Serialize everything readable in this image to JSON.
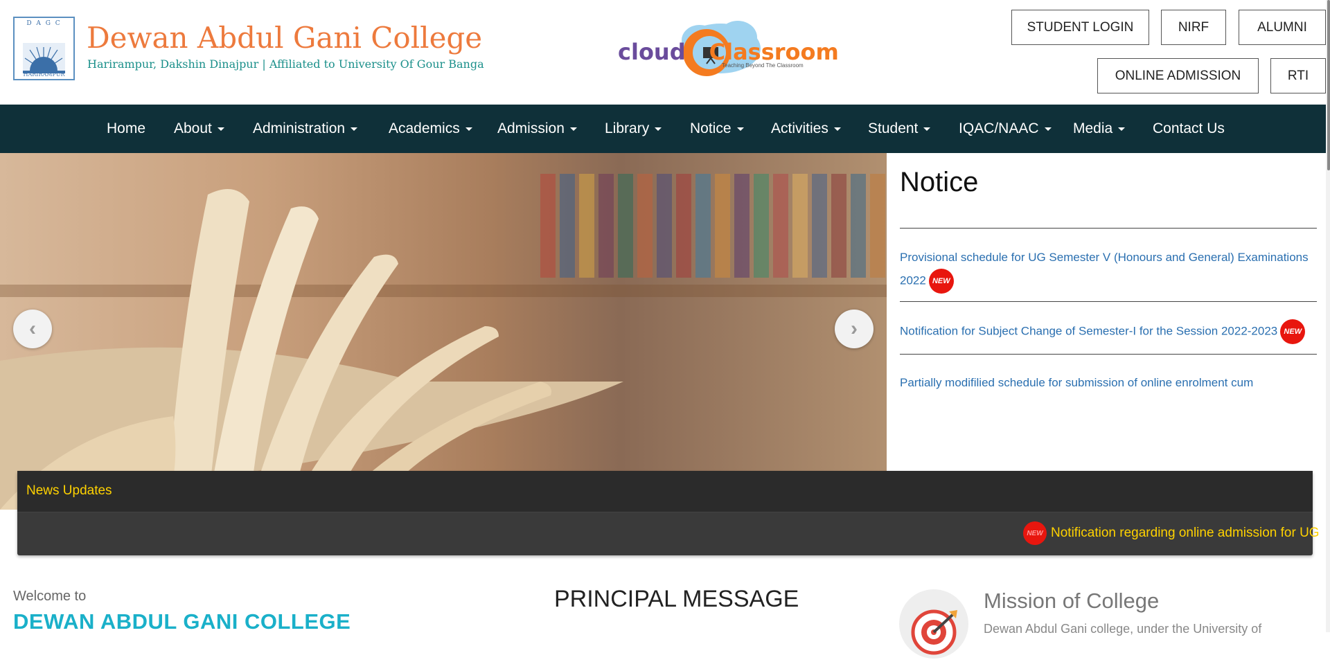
{
  "header": {
    "seal_top": "D A G C",
    "seal_bottom": "HARIRAMPUR",
    "title": "Dewan Abdul Gani College",
    "subtitle": "Harirampur, Dakshin Dinajpur | Affiliated to University Of Gour Banga",
    "partner_logo": {
      "part1": "cloud",
      "part2": "Classroom",
      "tagline": "Teaching Beyond The Classroom"
    },
    "buttons": {
      "student_login": "STUDENT LOGIN",
      "nirf": "NIRF",
      "alumni": "ALUMNI",
      "online_admission": "ONLINE ADMISSION",
      "rti": "RTI"
    }
  },
  "nav": {
    "items": [
      {
        "label": "Home",
        "dropdown": false
      },
      {
        "label": "About",
        "dropdown": true
      },
      {
        "label": "Administration",
        "dropdown": true
      },
      {
        "label": "Academics",
        "dropdown": true
      },
      {
        "label": "Admission",
        "dropdown": true
      },
      {
        "label": "Library",
        "dropdown": true
      },
      {
        "label": "Notice",
        "dropdown": true
      },
      {
        "label": "Activities",
        "dropdown": true
      },
      {
        "label": "Student",
        "dropdown": true
      },
      {
        "label": "IQAC/NAAC",
        "dropdown": true
      },
      {
        "label": "Media",
        "dropdown": true
      },
      {
        "label": "Contact Us",
        "dropdown": false
      }
    ]
  },
  "slider": {
    "prev_icon": "chevron-left-icon",
    "next_icon": "chevron-right-icon"
  },
  "notice": {
    "title": "Notice",
    "items": [
      {
        "text": "Provisional schedule for UG Semester V (Honours and General) Examinations 2022",
        "is_new": true
      },
      {
        "text": "Notification for Subject Change of Semester-I for the Session 2022-2023",
        "is_new": true
      },
      {
        "text": "Partially modifilied schedule for submission of online enrolment cum",
        "is_new": false
      }
    ],
    "new_label": "NEW"
  },
  "news": {
    "title": "News Updates",
    "ticker_text": "Notification regarding online admission for UG",
    "new_label": "NEW"
  },
  "welcome": {
    "small": "Welcome to",
    "college": "DEWAN ABDUL GANI COLLEGE"
  },
  "principal": {
    "title": "PRINCIPAL MESSAGE"
  },
  "mission": {
    "title": "Mission of College",
    "text": "Dewan Abdul Gani college, under the University of",
    "icon": "target-icon"
  },
  "colors": {
    "nav_bg": "#0f3039",
    "title_orange": "#ed7a3d",
    "subtitle_teal": "#1a8f8a",
    "link_blue": "#2a6fb0",
    "news_yellow": "#ffd200",
    "badge_red": "#e8160e",
    "welcome_cyan": "#1ab0c9"
  }
}
